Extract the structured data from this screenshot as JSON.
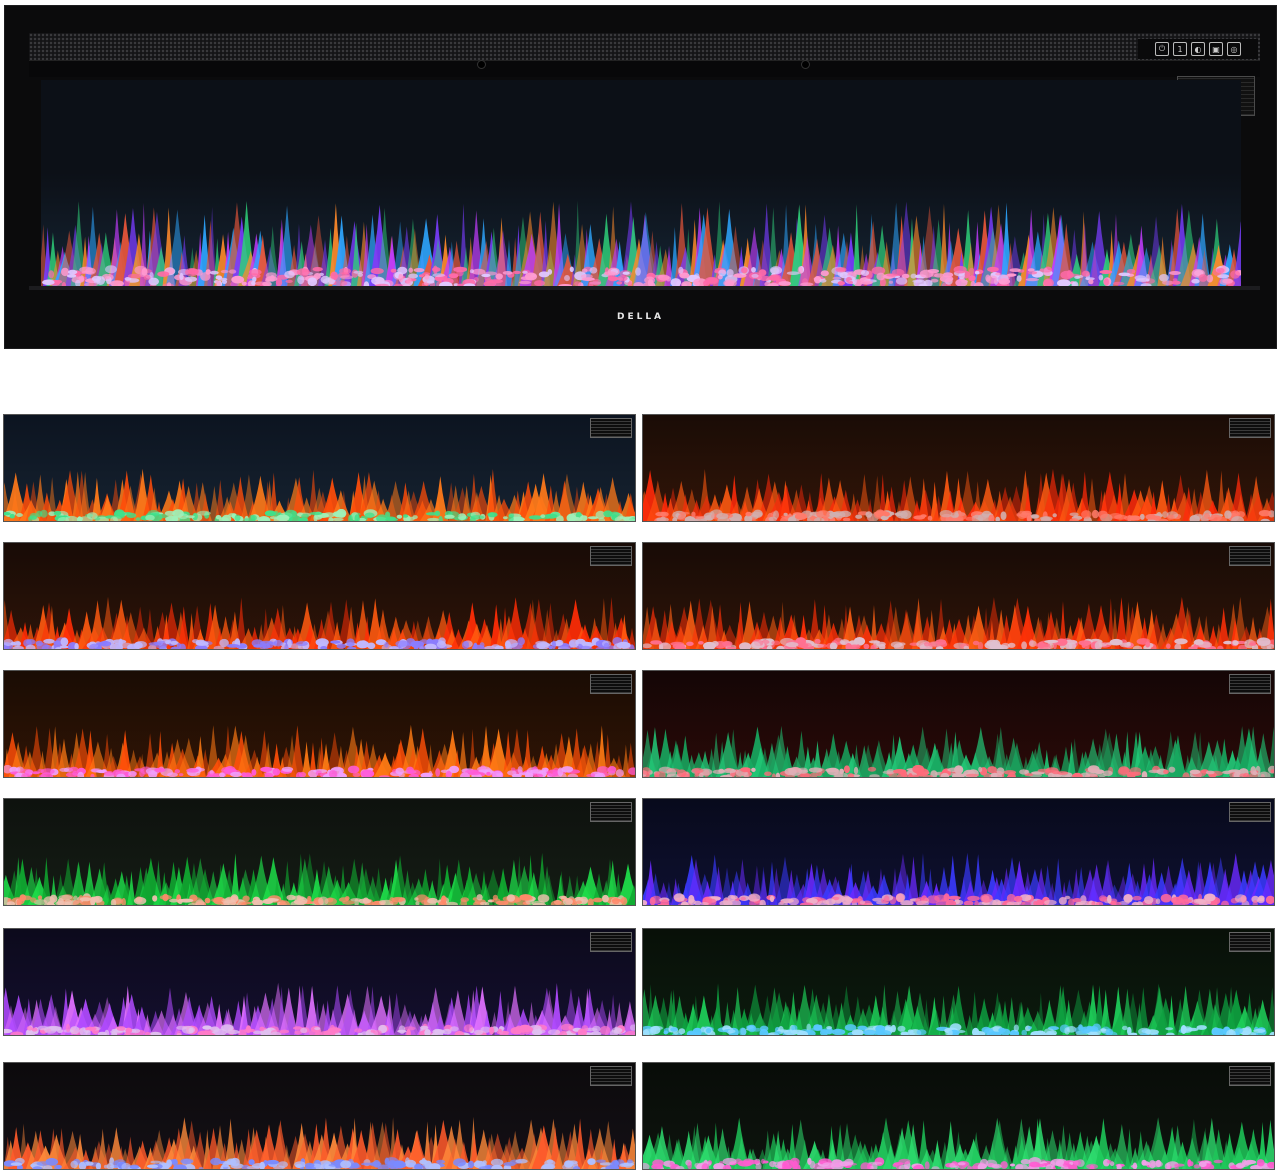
{
  "brand": "DELLA",
  "controls": [
    {
      "name": "power-icon",
      "glyph": "⏻"
    },
    {
      "name": "timer-icon",
      "glyph": "1"
    },
    {
      "name": "flame-icon",
      "glyph": "◐"
    },
    {
      "name": "heat-icon",
      "glyph": "▣"
    },
    {
      "name": "color-icon",
      "glyph": "◎"
    }
  ],
  "main_flame": {
    "bg": [
      "#0c1017",
      "#152433"
    ],
    "flames": [
      "#e8563a",
      "#7a3cff",
      "#2fd07a",
      "#ff8a2a",
      "#c23cff",
      "#2ea6ff"
    ],
    "embers": [
      "#ff6aa8",
      "#e0c8ff",
      "#ff9ad0"
    ]
  },
  "variants": [
    {
      "bg": [
        "#0c1420",
        "#162230"
      ],
      "flames": [
        "#ff7a1a",
        "#ff4d0a"
      ],
      "embers": [
        "#3ee08a",
        "#9ef0b8"
      ]
    },
    {
      "bg": [
        "#1a0c06",
        "#321508"
      ],
      "flames": [
        "#ff5a12",
        "#ff2a0a"
      ],
      "embers": [
        "#ff7a6a",
        "#d0b0b0"
      ]
    },
    {
      "bg": [
        "#180b06",
        "#2e1408"
      ],
      "flames": [
        "#ff5a10",
        "#ff2d06"
      ],
      "embers": [
        "#8a7cff",
        "#c0b8ff"
      ]
    },
    {
      "bg": [
        "#180b06",
        "#2e1408"
      ],
      "flames": [
        "#ff6014",
        "#ff3008"
      ],
      "embers": [
        "#ff7090",
        "#e0c0d0"
      ]
    },
    {
      "bg": [
        "#1a0c04",
        "#301405"
      ],
      "flames": [
        "#ff7a14",
        "#ff4f08"
      ],
      "embers": [
        "#ff5ad8",
        "#f0a0ff"
      ]
    },
    {
      "bg": [
        "#140606",
        "#2a0a08"
      ],
      "flames": [
        "#22c978",
        "#18a860"
      ],
      "embers": [
        "#ff6a7a",
        "#e0b0b8"
      ]
    },
    {
      "bg": [
        "#0e120e",
        "#141c14"
      ],
      "flames": [
        "#1ee04a",
        "#10a830"
      ],
      "embers": [
        "#ff8a6a",
        "#f0c0b0"
      ]
    },
    {
      "bg": [
        "#080a1c",
        "#0e1030"
      ],
      "flames": [
        "#3a3aff",
        "#6a2aff"
      ],
      "embers": [
        "#ff6a9a",
        "#f0b0c8"
      ]
    },
    {
      "bg": [
        "#0c0a1c",
        "#140f2e"
      ],
      "flames": [
        "#b04aff",
        "#e070ff"
      ],
      "embers": [
        "#ff7ac8",
        "#e0c0f0"
      ]
    },
    {
      "bg": [
        "#081008",
        "#0c1a0e"
      ],
      "flames": [
        "#1ed05a",
        "#0ea040"
      ],
      "embers": [
        "#5ac8ff",
        "#a0e0ff"
      ]
    },
    {
      "bg": [
        "#0c0a0c",
        "#141016"
      ],
      "flames": [
        "#ff5a2a",
        "#ff8a3a"
      ],
      "embers": [
        "#7a8aff",
        "#b0c0ff"
      ]
    },
    {
      "bg": [
        "#080c08",
        "#0e140e"
      ],
      "flames": [
        "#1ec85a",
        "#2ee070"
      ],
      "embers": [
        "#ff5ad0",
        "#f0a0e8"
      ]
    }
  ]
}
